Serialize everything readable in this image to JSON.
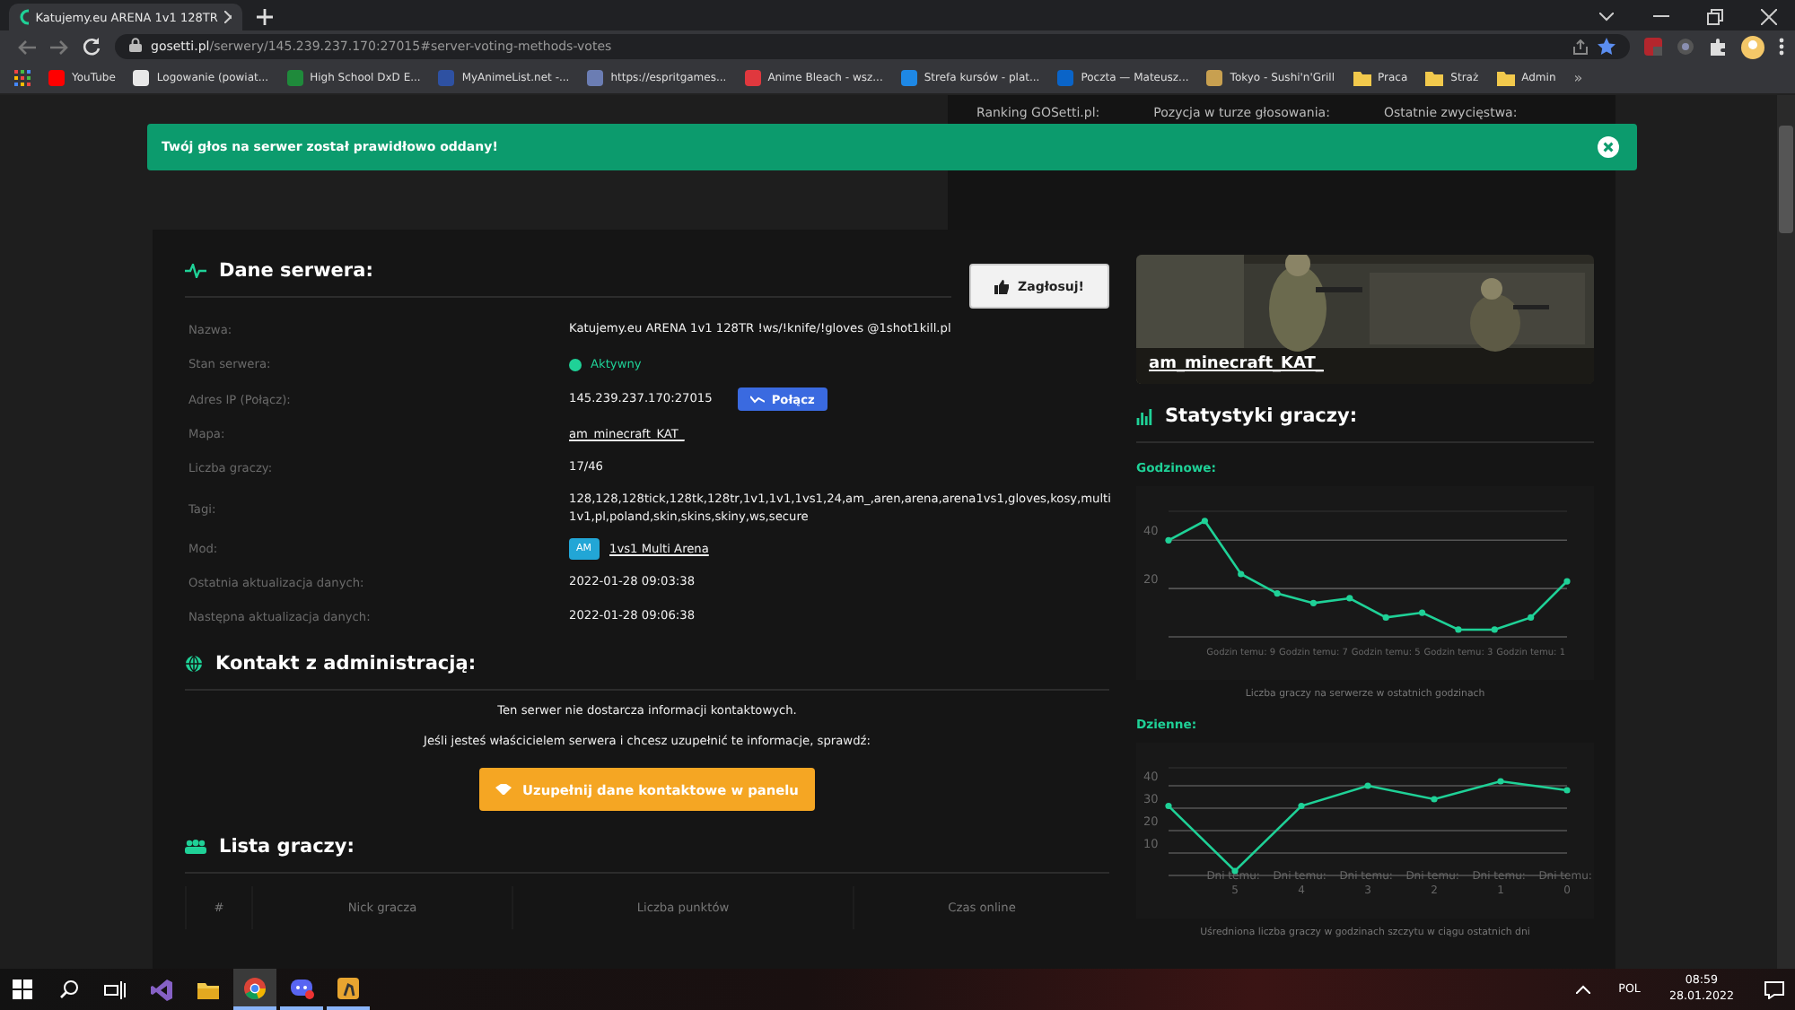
{
  "browser": {
    "tab": {
      "title": "Katujemy.eu ARENA 1v1 128TR",
      "selected": true
    },
    "address": {
      "host": "gosetti.pl",
      "path": "/serwery/145.239.237.170:27015#server-voting-methods-votes"
    },
    "bookmarks": [
      {
        "kind": "site",
        "label": "YouTube",
        "color": "#ff0000"
      },
      {
        "kind": "site",
        "label": "Logowanie (powiat...",
        "color": "#e8e8e8"
      },
      {
        "kind": "site",
        "label": "High School DxD E...",
        "color": "#1f8a3b"
      },
      {
        "kind": "site",
        "label": "MyAnimeList.net -...",
        "color": "#2e51a2"
      },
      {
        "kind": "site",
        "label": "https://espritgames...",
        "color": "#6b7db3"
      },
      {
        "kind": "site",
        "label": "Anime Bleach - wsz...",
        "color": "#e0383e"
      },
      {
        "kind": "site",
        "label": "Strefa kursów - plat...",
        "color": "#1e88e5"
      },
      {
        "kind": "site",
        "label": "Poczta — Mateusz...",
        "color": "#0a64c8"
      },
      {
        "kind": "site",
        "label": "Tokyo - Sushi'n'Grill",
        "color": "#c8a050"
      },
      {
        "kind": "folder",
        "label": "Praca",
        "color": "#f2c94c"
      },
      {
        "kind": "folder",
        "label": "Straż",
        "color": "#f2c94c"
      },
      {
        "kind": "folder",
        "label": "Admin",
        "color": "#f2c94c"
      }
    ],
    "bookmarks_more": "»"
  },
  "header_stats": [
    "Ranking GOSetti.pl:",
    "Pozycja w turze głosowania:",
    "Ostatnie zwycięstwa:"
  ],
  "toast": {
    "message": "Twój głos na serwer został prawidłowo oddany!"
  },
  "server_data": {
    "title": "Dane serwera:",
    "vote_button": "Zagłosuj!",
    "rows": [
      {
        "kind": "text",
        "label": "Nazwa:",
        "value": "Katujemy.eu ARENA 1v1 128TR !ws/!knife/!gloves @1shot1kill.pl"
      },
      {
        "kind": "status",
        "label": "Stan serwera:",
        "value": "Aktywny"
      },
      {
        "kind": "ip",
        "label": "Adres IP (Połącz):",
        "value": "145.239.237.170:27015",
        "button": "Połącz"
      },
      {
        "kind": "link",
        "label": "Mapa:",
        "value": "am_minecraft_KAT_"
      },
      {
        "kind": "text",
        "label": "Liczba graczy:",
        "value": "17/46"
      },
      {
        "kind": "text",
        "label": "Tagi:",
        "value": "128,128,128tick,128tk,128tr,1v1,1v1,1vs1,24,am_,aren,arena,arena1vs1,gloves,kosy,multi 1v1,pl,poland,skin,skins,skiny,ws,secure"
      },
      {
        "kind": "mod",
        "label": "Mod:",
        "badge": "AM",
        "value": "1vs1 Multi Arena"
      },
      {
        "kind": "text",
        "label": "Ostatnia aktualizacja danych:",
        "value": "2022-01-28 09:03:38"
      },
      {
        "kind": "text",
        "label": "Następna aktualizacja danych:",
        "value": "2022-01-28 09:06:38"
      }
    ]
  },
  "contact": {
    "title": "Kontakt z administracją:",
    "lines": [
      "Ten serwer nie dostarcza informacji kontaktowych.",
      "Jeśli jesteś właścicielem serwera i chcesz uzupełnić te informacje, sprawdź:"
    ],
    "button": "Uzupełnij dane kontaktowe w panelu"
  },
  "players": {
    "title": "Lista graczy:",
    "columns": [
      "#",
      "Nick gracza",
      "Liczba punktów",
      "Czas online"
    ]
  },
  "map_card": {
    "name": "am_minecraft_KAT_"
  },
  "stats": {
    "title": "Statystyki graczy:",
    "hourly": {
      "title": "Godzinowe:",
      "caption": "Liczba graczy na serwerze w ostatnich godzinach",
      "chart_data": {
        "type": "line",
        "x": [
          11,
          10,
          9,
          8,
          7,
          6,
          5,
          4,
          3,
          2,
          1,
          0
        ],
        "series": [
          {
            "color": "#1fd197",
            "values": [
              40,
              48,
              26,
              18,
              14,
              16,
              8,
              10,
              3,
              3,
              8,
              23
            ]
          }
        ],
        "xlim": [
          11,
          0
        ],
        "ylim": [
          0,
          52
        ],
        "yticks": [
          20,
          40
        ],
        "grid": true,
        "marker": true,
        "xticks": [
          {
            "value": 9,
            "label": "Godzin temu: 9"
          },
          {
            "value": 7,
            "label": "Godzin temu: 7"
          },
          {
            "value": 5,
            "label": "Godzin temu: 5"
          },
          {
            "value": 3,
            "label": "Godzin temu: 3"
          },
          {
            "value": 1,
            "label": "Godzin temu: 1"
          }
        ]
      }
    },
    "daily": {
      "title": "Dzienne:",
      "caption": "Uśredniona liczba graczy w godzinach szczytu w ciągu ostatnich dni",
      "chart_data": {
        "type": "line",
        "x": [
          6,
          5,
          4,
          3,
          2,
          1,
          0
        ],
        "series": [
          {
            "color": "#1fd197",
            "values": [
              31,
              2,
              31,
              40,
              34,
              42,
              38
            ]
          }
        ],
        "xlim": [
          6,
          0
        ],
        "ylim": [
          0,
          48
        ],
        "yticks": [
          10,
          20,
          30,
          40
        ],
        "grid": true,
        "marker": true,
        "xticks": [
          {
            "value": 5,
            "label": "Dni temu: 5"
          },
          {
            "value": 4,
            "label": "Dni temu: 4"
          },
          {
            "value": 3,
            "label": "Dni temu: 3"
          },
          {
            "value": 2,
            "label": "Dni temu: 2"
          },
          {
            "value": 1,
            "label": "Dni temu: 1"
          },
          {
            "value": 0,
            "label": "Dni temu: 0"
          }
        ]
      }
    }
  },
  "taskbar": {
    "language": "POL",
    "time": "08:59",
    "date": "28.01.2022"
  }
}
